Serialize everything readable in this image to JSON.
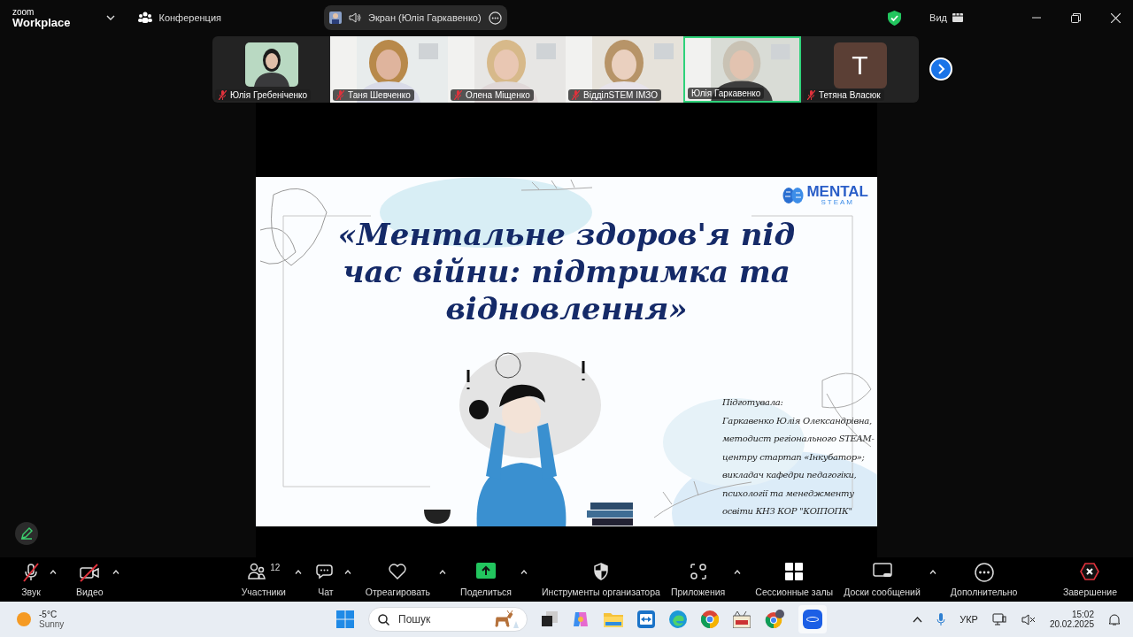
{
  "top_bar": {
    "logo_small": "zoom",
    "logo_large": "Workplace",
    "meeting_label": "Конференция",
    "share_pill": "Экран (Юлія Гаркавенко)",
    "view_label": "Вид"
  },
  "participants": [
    {
      "name": "Юлія Гребеніченко",
      "muted": true,
      "speaking": false
    },
    {
      "name": "Таня Шевченко",
      "kind": "video",
      "muted": true,
      "speaking": false
    },
    {
      "name": "Олена Міщенко",
      "kind": "video",
      "muted": true,
      "speaking": false
    },
    {
      "name": "ВідділSTEM ІМЗО",
      "kind": "video",
      "muted": true,
      "speaking": false
    },
    {
      "name": "Юлія Гаркавенко",
      "kind": "video",
      "muted": false,
      "speaking": true
    },
    {
      "name": "Тетяна Власюк",
      "kind": "avatar",
      "initial": "T",
      "muted": true,
      "speaking": false
    }
  ],
  "slide": {
    "logo_main": "MENTAL",
    "logo_sub": "STEAM",
    "title": "«Ментальне здоров'я під час війни: підтримка та відновлення»",
    "author_lines": [
      "Підготувала:",
      "Гаркавенко Юлія Олександрівна,",
      "методист регіонального STEAM-",
      "центру стартап «Інкубатор»;",
      "викладач кафедри педагогіки,",
      "психології та менеджменту",
      "освіти КНЗ КОР \"КОІПОПК\""
    ]
  },
  "toolbar": [
    {
      "kind": "audio",
      "label": "Звук",
      "muted": true,
      "menu": true
    },
    {
      "kind": "video",
      "label": "Видео",
      "muted": true,
      "menu": true
    },
    {
      "kind": "participants",
      "label": "Участники",
      "count": "12",
      "menu": true
    },
    {
      "kind": "chat",
      "label": "Чат",
      "menu": true
    },
    {
      "kind": "react",
      "label": "Отреагировать",
      "menu": true
    },
    {
      "kind": "share",
      "label": "Поделиться",
      "menu": true
    },
    {
      "kind": "host",
      "label": "Инструменты организатора",
      "menu": false
    },
    {
      "kind": "apps",
      "label": "Приложения",
      "menu": true
    },
    {
      "kind": "rooms",
      "label": "Сессионные залы",
      "menu": false
    },
    {
      "kind": "boards",
      "label": "Доски сообщений",
      "menu": true
    },
    {
      "kind": "more",
      "label": "Дополнительно",
      "menu": false
    },
    {
      "kind": "end",
      "label": "Завершение",
      "menu": false
    }
  ],
  "taskbar": {
    "temperature": "-5°C",
    "weather": "Sunny",
    "search_placeholder": "Пошук",
    "language": "УКР",
    "time": "15:02",
    "date": "20.02.2025"
  }
}
